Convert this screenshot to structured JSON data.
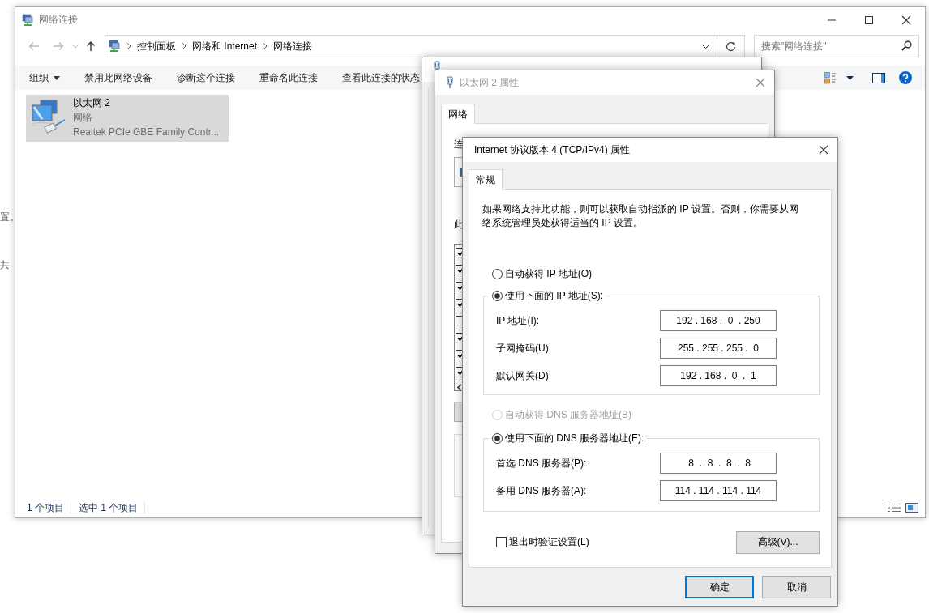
{
  "desktop_fragments": [
    {
      "text": "置。"
    },
    {
      "text": "共"
    }
  ],
  "explorer": {
    "title": "网络连接",
    "breadcrumbs": [
      "控制面板",
      "网络和 Internet",
      "网络连接"
    ],
    "search": {
      "placeholder": "搜索\"网络连接\""
    },
    "toolbar": [
      {
        "label": "组织",
        "kind": "menu"
      },
      {
        "label": "禁用此网络设备",
        "kind": "command"
      },
      {
        "label": "诊断这个连接",
        "kind": "command"
      },
      {
        "label": "重命名此连接",
        "kind": "command"
      },
      {
        "label": "查看此连接的状态",
        "kind": "command"
      }
    ],
    "items": [
      {
        "name": "以太网 2",
        "type": "网络",
        "device": "Realtek PCIe GBE Family Contr...",
        "selected": true
      }
    ],
    "status_bar": [
      "1 个项目",
      "选中 1 个项目"
    ]
  },
  "properties_window": {
    "title": "以太网 2 属性",
    "tabs": [
      {
        "label": "网络",
        "selected": true
      }
    ],
    "connect_label": "连",
    "components_label": "此",
    "components": [
      {
        "checked": true
      },
      {
        "checked": true
      },
      {
        "checked": true
      },
      {
        "checked": true
      },
      {
        "checked": false
      },
      {
        "checked": true
      },
      {
        "checked": true
      },
      {
        "checked": true
      }
    ]
  },
  "ipv4_dialog": {
    "title": "Internet 协议版本 4 (TCP/IPv4) 属性",
    "tabs": [
      {
        "label": "常规",
        "selected": true
      }
    ],
    "description": "如果网络支持此功能，则可以获取自动指派的 IP 设置。否则，你需要从网络系统管理员处获得适当的 IP 设置。",
    "ip_auto": {
      "label": "自动获得 IP 地址(O)",
      "selected": false,
      "disabled": false
    },
    "ip_manual": {
      "label": "使用下面的 IP 地址(S):",
      "selected": true,
      "disabled": false,
      "fields": [
        {
          "label": "IP 地址(I):",
          "value": "192 . 168 .  0  . 250"
        },
        {
          "label": "子网掩码(U):",
          "value": "255 . 255 . 255 .  0"
        },
        {
          "label": "默认网关(D):",
          "value": "192 . 168 .  0  .  1"
        }
      ]
    },
    "dns_auto": {
      "label": "自动获得 DNS 服务器地址(B)",
      "selected": false,
      "disabled": true
    },
    "dns_manual": {
      "label": "使用下面的 DNS 服务器地址(E):",
      "selected": true,
      "disabled": false,
      "fields": [
        {
          "label": "首选 DNS 服务器(P):",
          "value": " 8  .  8  .  8  .  8"
        },
        {
          "label": "备用 DNS 服务器(A):",
          "value": "114 . 114 . 114 . 114"
        }
      ]
    },
    "validate": {
      "label": "退出时验证设置(L)",
      "checked": false
    },
    "advanced_button": "高级(V)...",
    "buttons": [
      {
        "label": "确定",
        "default": true
      },
      {
        "label": "取消",
        "default": false
      }
    ]
  }
}
